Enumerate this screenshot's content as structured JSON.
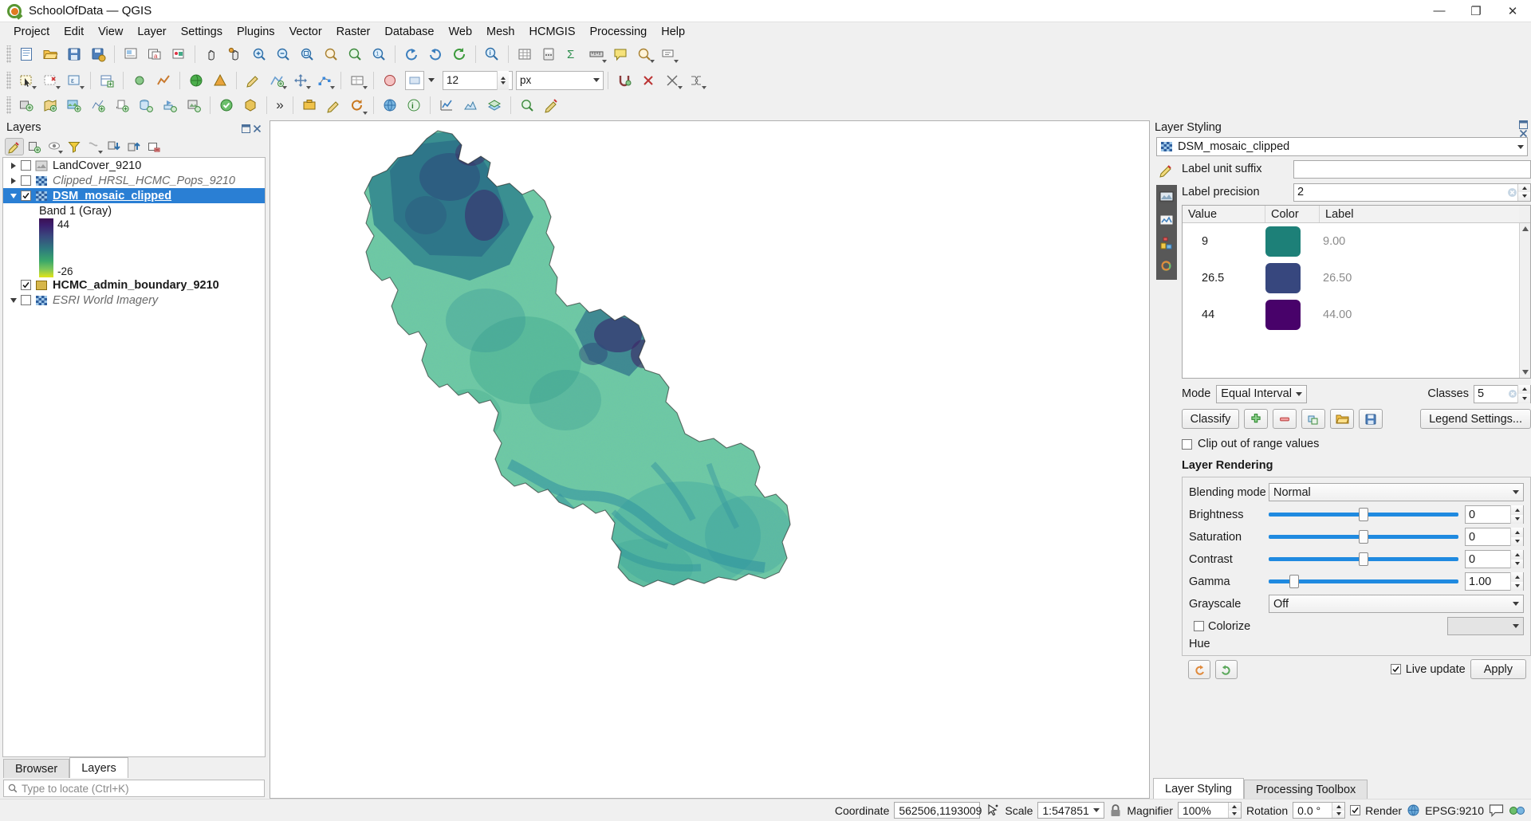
{
  "window": {
    "title": "SchoolOfData — QGIS",
    "logo_icon": "qgis-logo-icon",
    "minimize_label": "—",
    "maximize_label": "❐",
    "close_label": "✕"
  },
  "menu": {
    "items": [
      {
        "label": "Project"
      },
      {
        "label": "Edit"
      },
      {
        "label": "View"
      },
      {
        "label": "Layer"
      },
      {
        "label": "Settings"
      },
      {
        "label": "Plugins"
      },
      {
        "label": "Vector"
      },
      {
        "label": "Raster"
      },
      {
        "label": "Database"
      },
      {
        "label": "Web"
      },
      {
        "label": "Mesh"
      },
      {
        "label": "HCMGIS"
      },
      {
        "label": "Processing"
      },
      {
        "label": "Help"
      }
    ]
  },
  "toolbar": {
    "overflow_label": "»",
    "size_value": "12",
    "size_unit": "px"
  },
  "layers_panel": {
    "title": "Layers",
    "toolbar_icons": [
      "open-layer-styling-icon",
      "add-group-icon",
      "manage-visibility-icon",
      "filter-legend-icon",
      "filter-legend-expression-icon",
      "expand-all-icon",
      "collapse-all-icon",
      "remove-layer-icon"
    ],
    "items": [
      {
        "name": "LandCover_9210",
        "checked": false,
        "expandable": true,
        "expanded": false,
        "selected": false,
        "style": "normal",
        "icon": "raster-layer-icon"
      },
      {
        "name": "Clipped_HRSL_HCMC_Pops_9210",
        "checked": false,
        "expandable": true,
        "expanded": false,
        "selected": false,
        "style": "italic",
        "icon": "raster-layer-icon"
      },
      {
        "name": "DSM_mosaic_clipped",
        "checked": true,
        "expandable": true,
        "expanded": true,
        "selected": true,
        "style": "selected",
        "icon": "raster-layer-icon"
      },
      {
        "name": "HCMC_admin_boundary_9210",
        "checked": true,
        "expandable": false,
        "expanded": false,
        "selected": false,
        "style": "bold",
        "icon": "polygon-layer-icon"
      },
      {
        "name": "ESRI World Imagery",
        "checked": false,
        "expandable": true,
        "expanded": false,
        "selected": false,
        "style": "italic",
        "icon": "raster-layer-icon"
      }
    ],
    "band_label": "Band 1 (Gray)",
    "ramp_max_label": "44",
    "ramp_min_label": "-26",
    "tabs": [
      {
        "label": "Browser",
        "active": false
      },
      {
        "label": "Layers",
        "active": true
      }
    ],
    "locator_placeholder": "Type to locate (Ctrl+K)",
    "locator_icon": "search-icon"
  },
  "styling_panel": {
    "title": "Layer Styling",
    "layer_combo_value": "DSM_mosaic_clipped",
    "layer_combo_icon": "raster-layer-icon",
    "rail_icons": [
      "symbology-icon",
      "transparency-icon",
      "histogram-icon",
      "rendering-icon",
      "undo-redo-icon"
    ],
    "label_unit_suffix_label": "Label unit suffix",
    "label_unit_suffix_value": "",
    "label_precision_label": "Label precision",
    "label_precision_value": "2",
    "table": {
      "headers": [
        "Value",
        "Color",
        "Label"
      ],
      "rows": [
        {
          "value": "9",
          "color": "#1d8078",
          "label": "9.00"
        },
        {
          "value": "26.5",
          "color": "#37477e",
          "label": "26.50"
        },
        {
          "value": "44",
          "color": "#48026a",
          "label": "44.00"
        }
      ]
    },
    "mode_label": "Mode",
    "mode_value": "Equal Interval",
    "classes_label": "Classes",
    "classes_value": "5",
    "classify_label": "Classify",
    "add_class_icon": "add-icon",
    "remove_class_icon": "remove-icon",
    "copy_icon": "duplicate-icon",
    "load_icon": "folder-open-icon",
    "save_icon": "save-icon",
    "legend_settings_label": "Legend Settings...",
    "clip_label": "Clip out of range values",
    "clip_checked": false,
    "rendering_title": "Layer Rendering",
    "blending_label": "Blending mode",
    "blending_value": "Normal",
    "brightness_label": "Brightness",
    "brightness_value": "0",
    "saturation_label": "Saturation",
    "saturation_value": "0",
    "contrast_label": "Contrast",
    "contrast_value": "0",
    "gamma_label": "Gamma",
    "gamma_value": "1.00",
    "grayscale_label": "Grayscale",
    "grayscale_value": "Off",
    "colorize_label": "Colorize",
    "colorize_checked": false,
    "hue_label": "Hue",
    "undo_icon": "undo-icon",
    "redo_icon": "redo-icon",
    "live_update_label": "Live update",
    "live_update_checked": true,
    "apply_label": "Apply",
    "tabs": [
      {
        "label": "Layer Styling",
        "active": true
      },
      {
        "label": "Processing Toolbox",
        "active": false
      }
    ]
  },
  "statusbar": {
    "coordinate_label": "Coordinate",
    "coordinate_value": "562506,1193009",
    "coordinate_toggle_icon": "cursor-capture-icon",
    "scale_label": "Scale",
    "scale_value": "1:547851",
    "lock_icon": "lock-scale-icon",
    "magnifier_label": "Magnifier",
    "magnifier_value": "100%",
    "rotation_label": "Rotation",
    "rotation_value": "0.0 °",
    "render_label": "Render",
    "render_checked": true,
    "crs_value": "EPSG:9210",
    "crs_icon": "globe-icon",
    "messages_icon": "message-log-icon",
    "plugins_icon": "plugin-status-icon"
  },
  "colors": {
    "accent_blue": "#2a7fd4",
    "slider_blue": "#1f8ae0",
    "panel_bg": "#f0f0f0",
    "map_land_green": "#4cba78",
    "rail_dark": "#585858"
  }
}
